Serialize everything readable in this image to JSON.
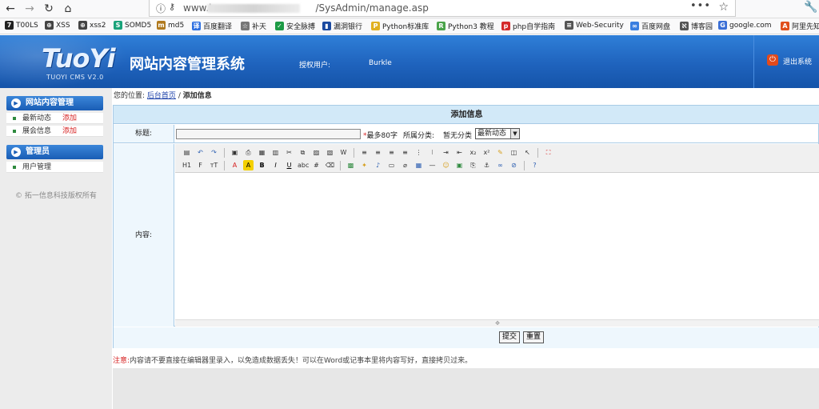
{
  "browser": {
    "url_prefix": "www.l",
    "url_suffix": "/SysAdmin/manage.asp",
    "more_icon": "ellipsis-icon",
    "star_icon": "bookmark-star-icon"
  },
  "bookmarks": [
    {
      "label": "T00LS",
      "icon": "tools-icon",
      "color": "#222222"
    },
    {
      "label": "XSS",
      "icon": "globe-icon",
      "color": "#444444"
    },
    {
      "label": "xss2",
      "icon": "globe-icon",
      "color": "#444444"
    },
    {
      "label": "SOMD5",
      "icon": "somd5-icon",
      "color": "#1aa37a"
    },
    {
      "label": "md5",
      "icon": "md5-icon",
      "color": "#b07a1f"
    },
    {
      "label": "百度翻译",
      "icon": "baidu-translate-icon",
      "color": "#2d6fe0"
    },
    {
      "label": "补天",
      "icon": "butian-icon",
      "color": "#777777"
    },
    {
      "label": "安全脉搏",
      "icon": "shield-icon",
      "color": "#1c9a45"
    },
    {
      "label": "漏洞银行",
      "icon": "bank-icon",
      "color": "#1b4aa0"
    },
    {
      "label": "Python标准库",
      "icon": "python-icon",
      "color": "#e0b020"
    },
    {
      "label": "Python3 教程",
      "icon": "runoob-icon",
      "color": "#4aa34a"
    },
    {
      "label": "php自学指南",
      "icon": "php-icon",
      "color": "#d42a2a"
    },
    {
      "label": "Web-Security",
      "icon": "lines-icon",
      "color": "#555555"
    },
    {
      "label": "百度网盘",
      "icon": "baidu-pan-icon",
      "color": "#3a7fe0"
    },
    {
      "label": "博客园",
      "icon": "cnblogs-icon",
      "color": "#555555"
    },
    {
      "label": "google.com",
      "icon": "google-icon",
      "color": "#3b6fd6"
    },
    {
      "label": "阿里先知",
      "icon": "aliyun-icon",
      "color": "#e0501c"
    }
  ],
  "header": {
    "logo": "TuoYi",
    "logo_sub": "TUOYI CMS V2.0",
    "system_title": "网站内容管理系统",
    "auth_label": "授权用户:",
    "auth_user": "Burkle",
    "exit_label": "退出系统"
  },
  "sidebar": {
    "group1": "网站内容管理",
    "items1": [
      {
        "label": "最新动态",
        "add": "添加"
      },
      {
        "label": "展会信息",
        "add": "添加"
      }
    ],
    "group2": "管理员",
    "items2": [
      {
        "label": "用户管理"
      }
    ],
    "copyright": "© 拓一信息科技版权所有"
  },
  "breadcrumb": {
    "prefix": "您的位置:",
    "home": "后台首页",
    "sep": "/",
    "current": "添加信息"
  },
  "form": {
    "title": "添加信息",
    "title_label": "标题:",
    "title_value": "",
    "required_star": "*",
    "max_hint": "最多80字",
    "category_label": "所属分类:",
    "category_value": "暂无分类",
    "category_select": "最新动态",
    "content_label": "内容:",
    "submit": "提交",
    "reset": "重置"
  },
  "note": {
    "warn": "注意:",
    "text": "内容请不要直接在编辑器里录入，以免造成数据丢失！可以在Word或记事本里将内容写好，直接拷贝过来。"
  },
  "toolbar": {
    "row1": [
      "source-icon",
      "undo-icon",
      "redo-icon",
      "sep",
      "preview-icon",
      "print-icon",
      "template-icon",
      "flash-icon",
      "cut-icon",
      "copy-icon",
      "paste-icon",
      "paste-text-icon",
      "paste-word-icon",
      "sep",
      "align-left-icon",
      "align-center-icon",
      "align-right-icon",
      "align-justify-icon",
      "ordered-list-icon",
      "unordered-list-icon",
      "indent-icon",
      "outdent-icon",
      "subscript-icon",
      "superscript-icon",
      "clear-format-icon",
      "select-all-icon",
      "pointer-icon",
      "sep",
      "fullscreen-icon"
    ],
    "row2": [
      "heading-icon",
      "font-family-icon",
      "font-size-icon",
      "sep",
      "font-color-icon",
      "highlight-icon",
      "bold-icon",
      "italic-icon",
      "underline-icon",
      "strikethrough-icon",
      "table-grid-icon",
      "eraser-icon",
      "sep",
      "image-icon",
      "flash-insert-icon",
      "media-icon",
      "file-icon",
      "attach-icon",
      "table-icon",
      "hr-icon",
      "emoticon-icon",
      "image-gallery-icon",
      "page-break-icon",
      "anchor-icon",
      "link-icon",
      "unlink-icon",
      "sep",
      "about-icon"
    ]
  }
}
